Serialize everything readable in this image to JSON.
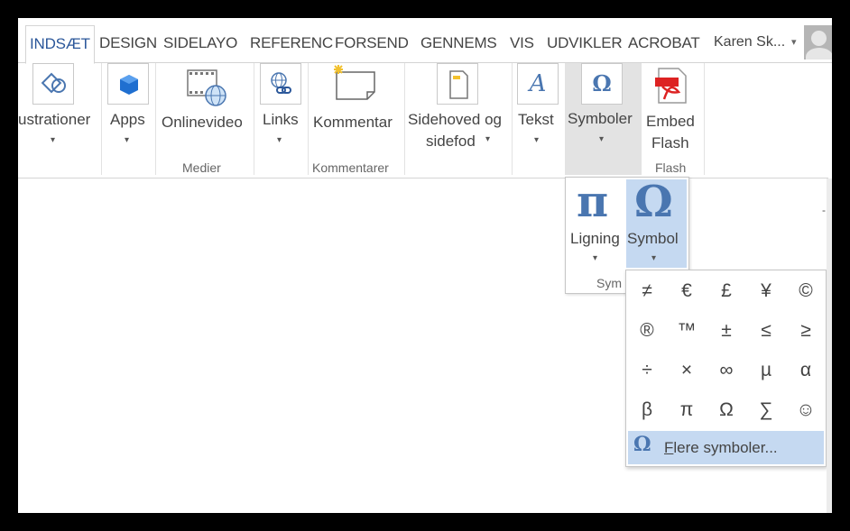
{
  "tabs": [
    {
      "label": "INDSÆT",
      "active": true
    },
    {
      "label": "DESIGN"
    },
    {
      "label": "SIDELAYO"
    },
    {
      "label": "REFERENC"
    },
    {
      "label": "FORSEND"
    },
    {
      "label": "GENNEMS"
    },
    {
      "label": "VIS"
    },
    {
      "label": "UDVIKLER"
    },
    {
      "label": "ACROBAT"
    }
  ],
  "user": {
    "name": "Karen Sk...",
    "caret": "▾"
  },
  "ribbon": {
    "illustrations": {
      "label": "ustrationer",
      "icon": "shapes-icon"
    },
    "apps": {
      "label": "Apps",
      "icon": "apps-cube-icon"
    },
    "onlinevideo": {
      "label": "Onlinevideo",
      "icon": "film-globe-icon"
    },
    "links": {
      "label": "Links",
      "icon": "globe-link-icon"
    },
    "comment": {
      "label": "Kommentar",
      "icon": "comment-icon"
    },
    "headerfooter": {
      "label1": "Sidehoved og",
      "label2": "sidefod",
      "icon": "page-icon"
    },
    "text": {
      "label": "Tekst",
      "icon": "text-a-icon"
    },
    "symbols": {
      "label": "Symboler",
      "icon": "omega-icon"
    },
    "embedflash": {
      "label1": "Embed",
      "label2": "Flash",
      "icon": "pdf-flash-icon"
    },
    "groups": {
      "media": "Medier",
      "comments": "Kommentarer",
      "flash": "Flash"
    }
  },
  "symbols_dropdown": {
    "equation": {
      "glyph": "π",
      "label": "Ligning"
    },
    "symbol": {
      "glyph": "Ω",
      "label": "Symbol"
    },
    "group_label": "Sym"
  },
  "gallery": {
    "rows": [
      [
        "≠",
        "€",
        "£",
        "¥",
        "©"
      ],
      [
        "®",
        "™",
        "±",
        "≤",
        "≥"
      ],
      [
        "÷",
        "×",
        "∞",
        "µ",
        "α"
      ],
      [
        "β",
        "π",
        "Ω",
        "∑",
        "☺"
      ]
    ],
    "more": {
      "glyph": "Ω",
      "accel": "F",
      "rest": "lere symboler..."
    }
  },
  "caret": "▾",
  "colors": {
    "accent": "#2b579a",
    "highlight": "#c5d9f1",
    "symbol_blue": "#4a76b0"
  }
}
